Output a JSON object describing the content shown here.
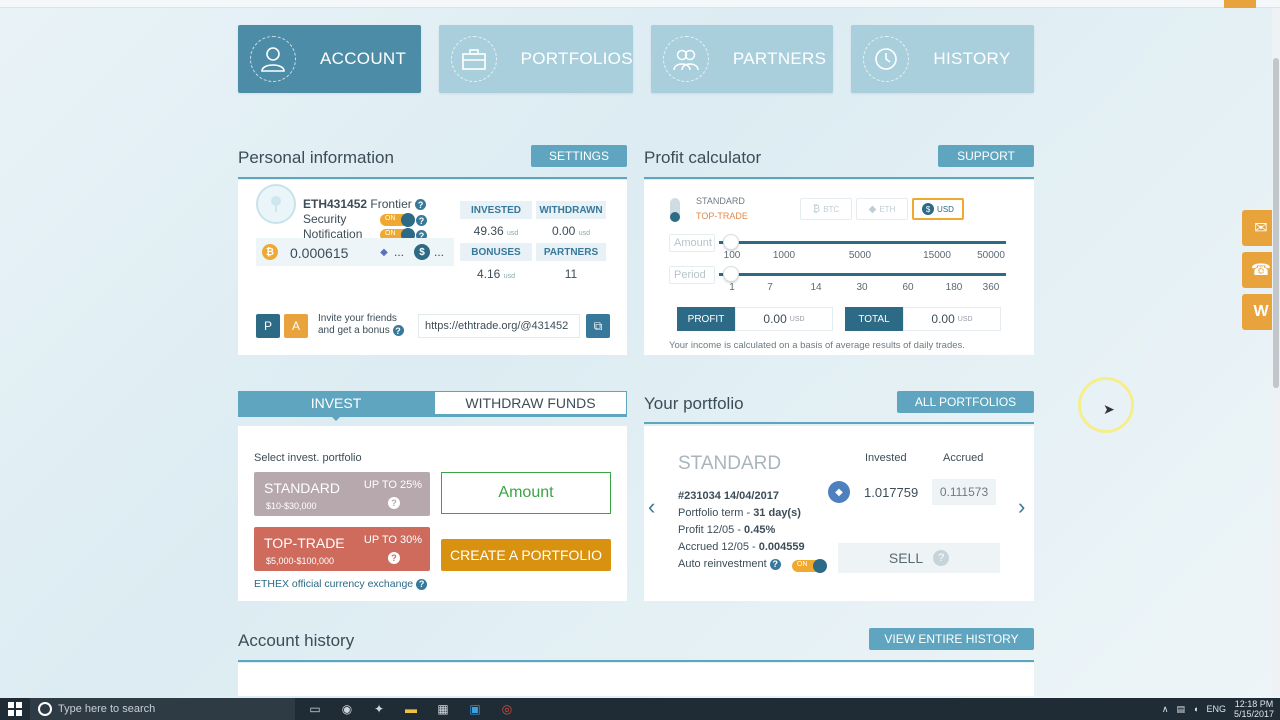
{
  "nav": [
    {
      "label": "ACCOUNT",
      "icon": "user-icon",
      "active": true
    },
    {
      "label": "PORTFOLIOS",
      "icon": "briefcase-icon",
      "active": false
    },
    {
      "label": "PARTNERS",
      "icon": "group-icon",
      "active": false
    },
    {
      "label": "HISTORY",
      "icon": "clock-icon",
      "active": false
    }
  ],
  "personal": {
    "title": "Personal information",
    "settings_label": "SETTINGS",
    "account_id": "ETH431452",
    "level": "Frontier",
    "security_label": "Security",
    "notification_label": "Notification",
    "toggle_on": "ON",
    "balance": "0.000615",
    "dots": "...",
    "stats": {
      "invested_label": "INVESTED",
      "invested": "49.36",
      "withdrawn_label": "WITHDRAWN",
      "withdrawn": "0.00",
      "bonuses_label": "BONUSES",
      "bonuses": "4.16",
      "partners_label": "PARTNERS",
      "partners": "11",
      "unit": "usd"
    },
    "p_label": "P",
    "a_label": "A",
    "invite_text": "Invite your friends and get a bonus",
    "ref_link": "https://ethtrade.org/@431452"
  },
  "calc": {
    "title": "Profit calculator",
    "support_label": "SUPPORT",
    "plan_standard": "STANDARD",
    "plan_toptrade": "TOP-TRADE",
    "currencies": [
      "BTC",
      "ETH",
      "USD"
    ],
    "amount_label": "Amount",
    "period_label": "Period",
    "amount_ticks": [
      "100",
      "1000",
      "5000",
      "15000",
      "50000"
    ],
    "period_ticks": [
      "1",
      "7",
      "14",
      "30",
      "60",
      "180",
      "360"
    ],
    "profit_label": "PROFIT",
    "profit_value": "0.00",
    "total_label": "TOTAL",
    "total_value": "0.00",
    "unit": "USD",
    "note": "Your income is calculated on a basis of average results of daily trades."
  },
  "invest": {
    "tab_invest": "INVEST",
    "tab_withdraw": "WITHDRAW FUNDS",
    "select_label": "Select invest. portfolio",
    "standard": {
      "name": "STANDARD",
      "range": "$10-$30,000",
      "upto": "UP TO 25%"
    },
    "toptrade": {
      "name": "TOP-TRADE",
      "range": "$5,000-$100,000",
      "upto": "UP TO 30%"
    },
    "amount_placeholder": "Amount",
    "create_label": "CREATE A PORTFOLIO",
    "exchange_label": "ETHEX official currency exchange"
  },
  "portfolio": {
    "title": "Your portfolio",
    "all_label": "ALL PORTFOLIOS",
    "name": "STANDARD",
    "id_date": "#231034 14/04/2017",
    "term_label": "Portfolio term - ",
    "term_value": "31 day(s)",
    "profit_label": "Profit 12/05 - ",
    "profit_value": "0.45%",
    "accrued_label": "Accrued 12/05 - ",
    "accrued_value": "0.004559",
    "reinvest_label": "Auto reinvestment",
    "invested_hdr": "Invested",
    "accrued_hdr": "Accrued",
    "invested_value": "1.017759",
    "accrued_amount": "0.111573",
    "sell_label": "SELL"
  },
  "history": {
    "title": "Account history",
    "view_label": "VIEW ENTIRE HISTORY"
  },
  "taskbar": {
    "search_placeholder": "Type here to search",
    "lang": "ENG",
    "time": "12:18 PM",
    "date": "5/15/2017"
  },
  "colors": {
    "accent": "#5fa5c0",
    "dark": "#2c6a86",
    "orange": "#d9920f",
    "green": "#3aa447"
  }
}
